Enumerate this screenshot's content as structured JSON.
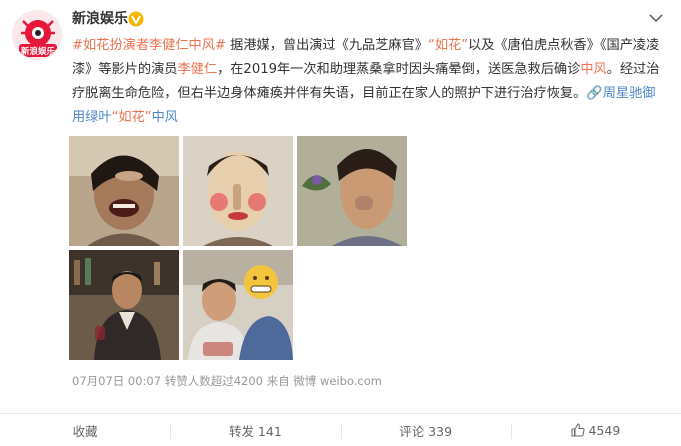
{
  "post": {
    "username": "新浪娱乐",
    "avatar_text": "新浪娱乐",
    "text": {
      "hashtag": "#如花扮演者李健仁中风#",
      "p1": " 据港媒，曾出演过《九品芝麻官》",
      "name1": "“如花”",
      "p2": "以及《唐伯虎点秋香》《国产凌凌漆》等影片的演员",
      "name2": "李健仁",
      "p3": "，在2019年一次和助理蒸桑拿时因头痛晕倒，送医急救后确诊",
      "stroke": "中风",
      "p4": "。经过治疗脱离生命危险，但右半边身体瘫痪并伴有失语，目前正在家人的照护下进行治疗恢复。",
      "link_icon": "🔗",
      "link_a": "周星驰御用绿叶",
      "link_b": "“如花”",
      "link_c": "中风"
    },
    "meta": "07月07日 00:07  转赞人数超过4200  来自 微博 weibo.com"
  },
  "actions": {
    "collect": "收藏",
    "repost": "转发 141",
    "comment": "评论 339",
    "like": "4549"
  },
  "colors": {
    "accent": "#eb7350",
    "link": "#4e87c8",
    "verified": "#f8b500"
  }
}
